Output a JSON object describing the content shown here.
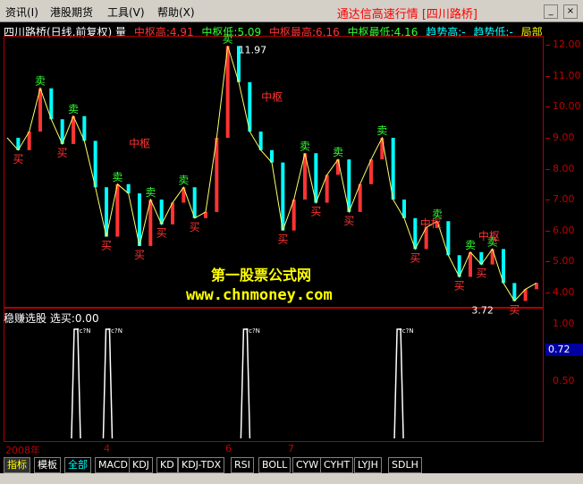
{
  "menu": {
    "items": [
      "资讯(I)",
      "港股期货",
      "工具(V)",
      "帮助(X)"
    ],
    "title": "通达信高速行情 [四川路桥]"
  },
  "header": {
    "name": "四川路桥(日线,前复权) 量",
    "zs_high_label": "中枢高:4.91",
    "zs_low_label": "中枢低:5.09",
    "zs_max_label": "中枢最高:6.16",
    "zs_min_label": "中枢最低:4.16",
    "trend_high_label": "趋势高:-",
    "trend_low_label": "趋势低:-",
    "local_label": "局部"
  },
  "colors": {
    "red": "#ff3333",
    "green": "#33ff33",
    "yellow": "#ffff00",
    "cyan": "#00ffff",
    "magenta": "#ff00ff",
    "white": "#ffffff",
    "axis": "#c00000"
  },
  "price_axis": [
    "12.00",
    "11.00",
    "10.00",
    "9.00",
    "8.00",
    "7.00",
    "6.00",
    "5.00",
    "4.00"
  ],
  "annotations": {
    "high_label": "11.97",
    "low_label": "3.72",
    "zs": "中枢",
    "buy": "买",
    "sell": "卖"
  },
  "indicator": {
    "title": "稳赚选股  选买:0.00",
    "axis": [
      "1.00",
      "0.50"
    ],
    "current_value": "0.72",
    "spike_label": "?c?N"
  },
  "timebar": [
    "2008年",
    "4",
    "6",
    "7"
  ],
  "watermark": {
    "line1": "第一股票公式网",
    "line2": "www.chnmoney.com"
  },
  "tabs": [
    "指标",
    "模板",
    "全部",
    "MACD",
    "KDJ",
    "KD",
    "KDJ-TDX",
    "RSI",
    "BOLL",
    "CYW",
    "CYHT",
    "LYJH",
    "SDLH"
  ],
  "chart_data": {
    "type": "line",
    "ylim": [
      3.5,
      12.3
    ],
    "series": [
      {
        "values": [
          9.0,
          8.6,
          9.2,
          10.6,
          9.6,
          8.8,
          9.7,
          8.9,
          7.4,
          5.8,
          7.5,
          7.2,
          5.5,
          7.0,
          6.2,
          6.9,
          7.4,
          6.4,
          6.6,
          9.0,
          11.97,
          10.8,
          9.2,
          8.6,
          8.2,
          6.0,
          7.0,
          8.5,
          6.9,
          7.8,
          8.3,
          6.6,
          7.5,
          8.3,
          9.0,
          7.0,
          6.4,
          5.4,
          6.1,
          6.3,
          5.2,
          4.5,
          5.3,
          4.9,
          5.4,
          4.3,
          3.72,
          4.1,
          4.3
        ]
      }
    ],
    "spikes_x": [
      0.13,
      0.19,
      0.45,
      0.74
    ]
  }
}
